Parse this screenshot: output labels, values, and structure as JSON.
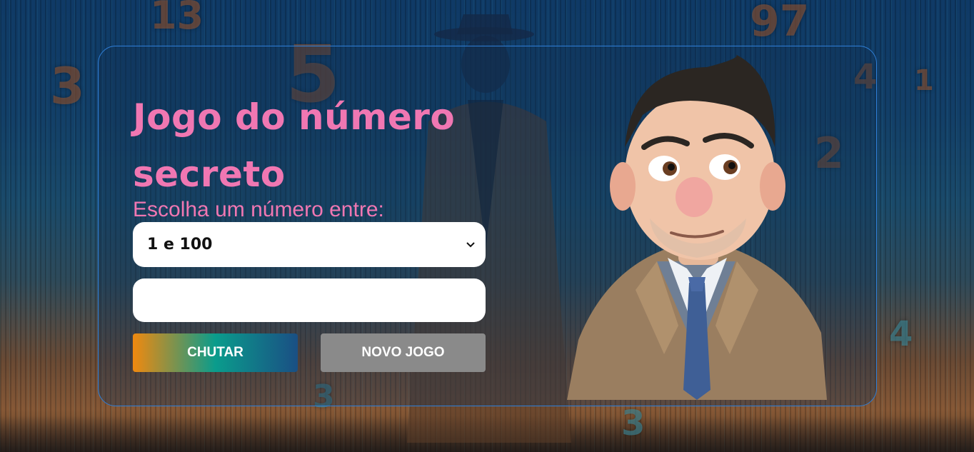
{
  "title": "Jogo do número secreto",
  "subtitle": "Escolha um número entre:",
  "range_select": {
    "selected": "1 e 100"
  },
  "guess_input": {
    "value": ""
  },
  "buttons": {
    "guess_label": "CHUTAR",
    "new_game_label": "NOVO JOGO"
  },
  "colors": {
    "title": "#f077b2",
    "card_border": "#2f7fd8",
    "guess_gradient_start": "#f0890f",
    "guess_gradient_mid": "#0a9c8c",
    "guess_gradient_end": "#1a4f84",
    "new_game_button": "#8a8a8a"
  },
  "icons": {
    "select_arrow": "chevron-down-icon"
  }
}
